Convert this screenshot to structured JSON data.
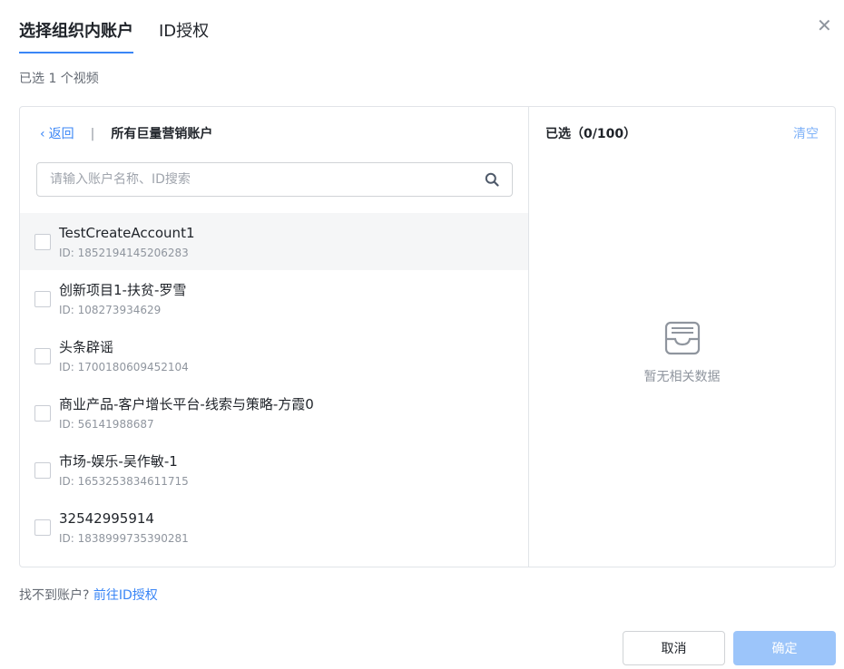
{
  "tabs": [
    {
      "label": "选择组织内账户",
      "active": true
    },
    {
      "label": "ID授权",
      "active": false
    }
  ],
  "close_icon": "close-icon",
  "selected_count": "已选 1 个视频",
  "left_panel": {
    "back_label": "返回",
    "separator": "|",
    "title": "所有巨量营销账户",
    "search": {
      "placeholder": "请输入账户名称、ID搜索",
      "value": ""
    },
    "accounts": [
      {
        "name": "TestCreateAccount1",
        "id": "ID: 1852194145206283"
      },
      {
        "name": "创新项目1-扶贫-罗雪",
        "id": "ID: 108273934629"
      },
      {
        "name": "头条辟谣",
        "id": "ID: 1700180609452104"
      },
      {
        "name": "商业产品-客户增长平台-线索与策略-方霞0",
        "id": "ID: 56141988687"
      },
      {
        "name": "市场-娱乐-吴作敏-1",
        "id": "ID: 1653253834611715"
      },
      {
        "name": "32542995914",
        "id": "ID: 1838999735390281"
      }
    ]
  },
  "right_panel": {
    "title": "已选（0/100）",
    "clear_label": "清空",
    "empty_text": "暂无相关数据"
  },
  "footer": {
    "hint": "找不到账户?",
    "link": "前往ID授权",
    "cancel_label": "取消",
    "ok_label": "确定"
  },
  "colors": {
    "accent": "#3a86f6",
    "accent_disabled": "#9cc5fa"
  }
}
